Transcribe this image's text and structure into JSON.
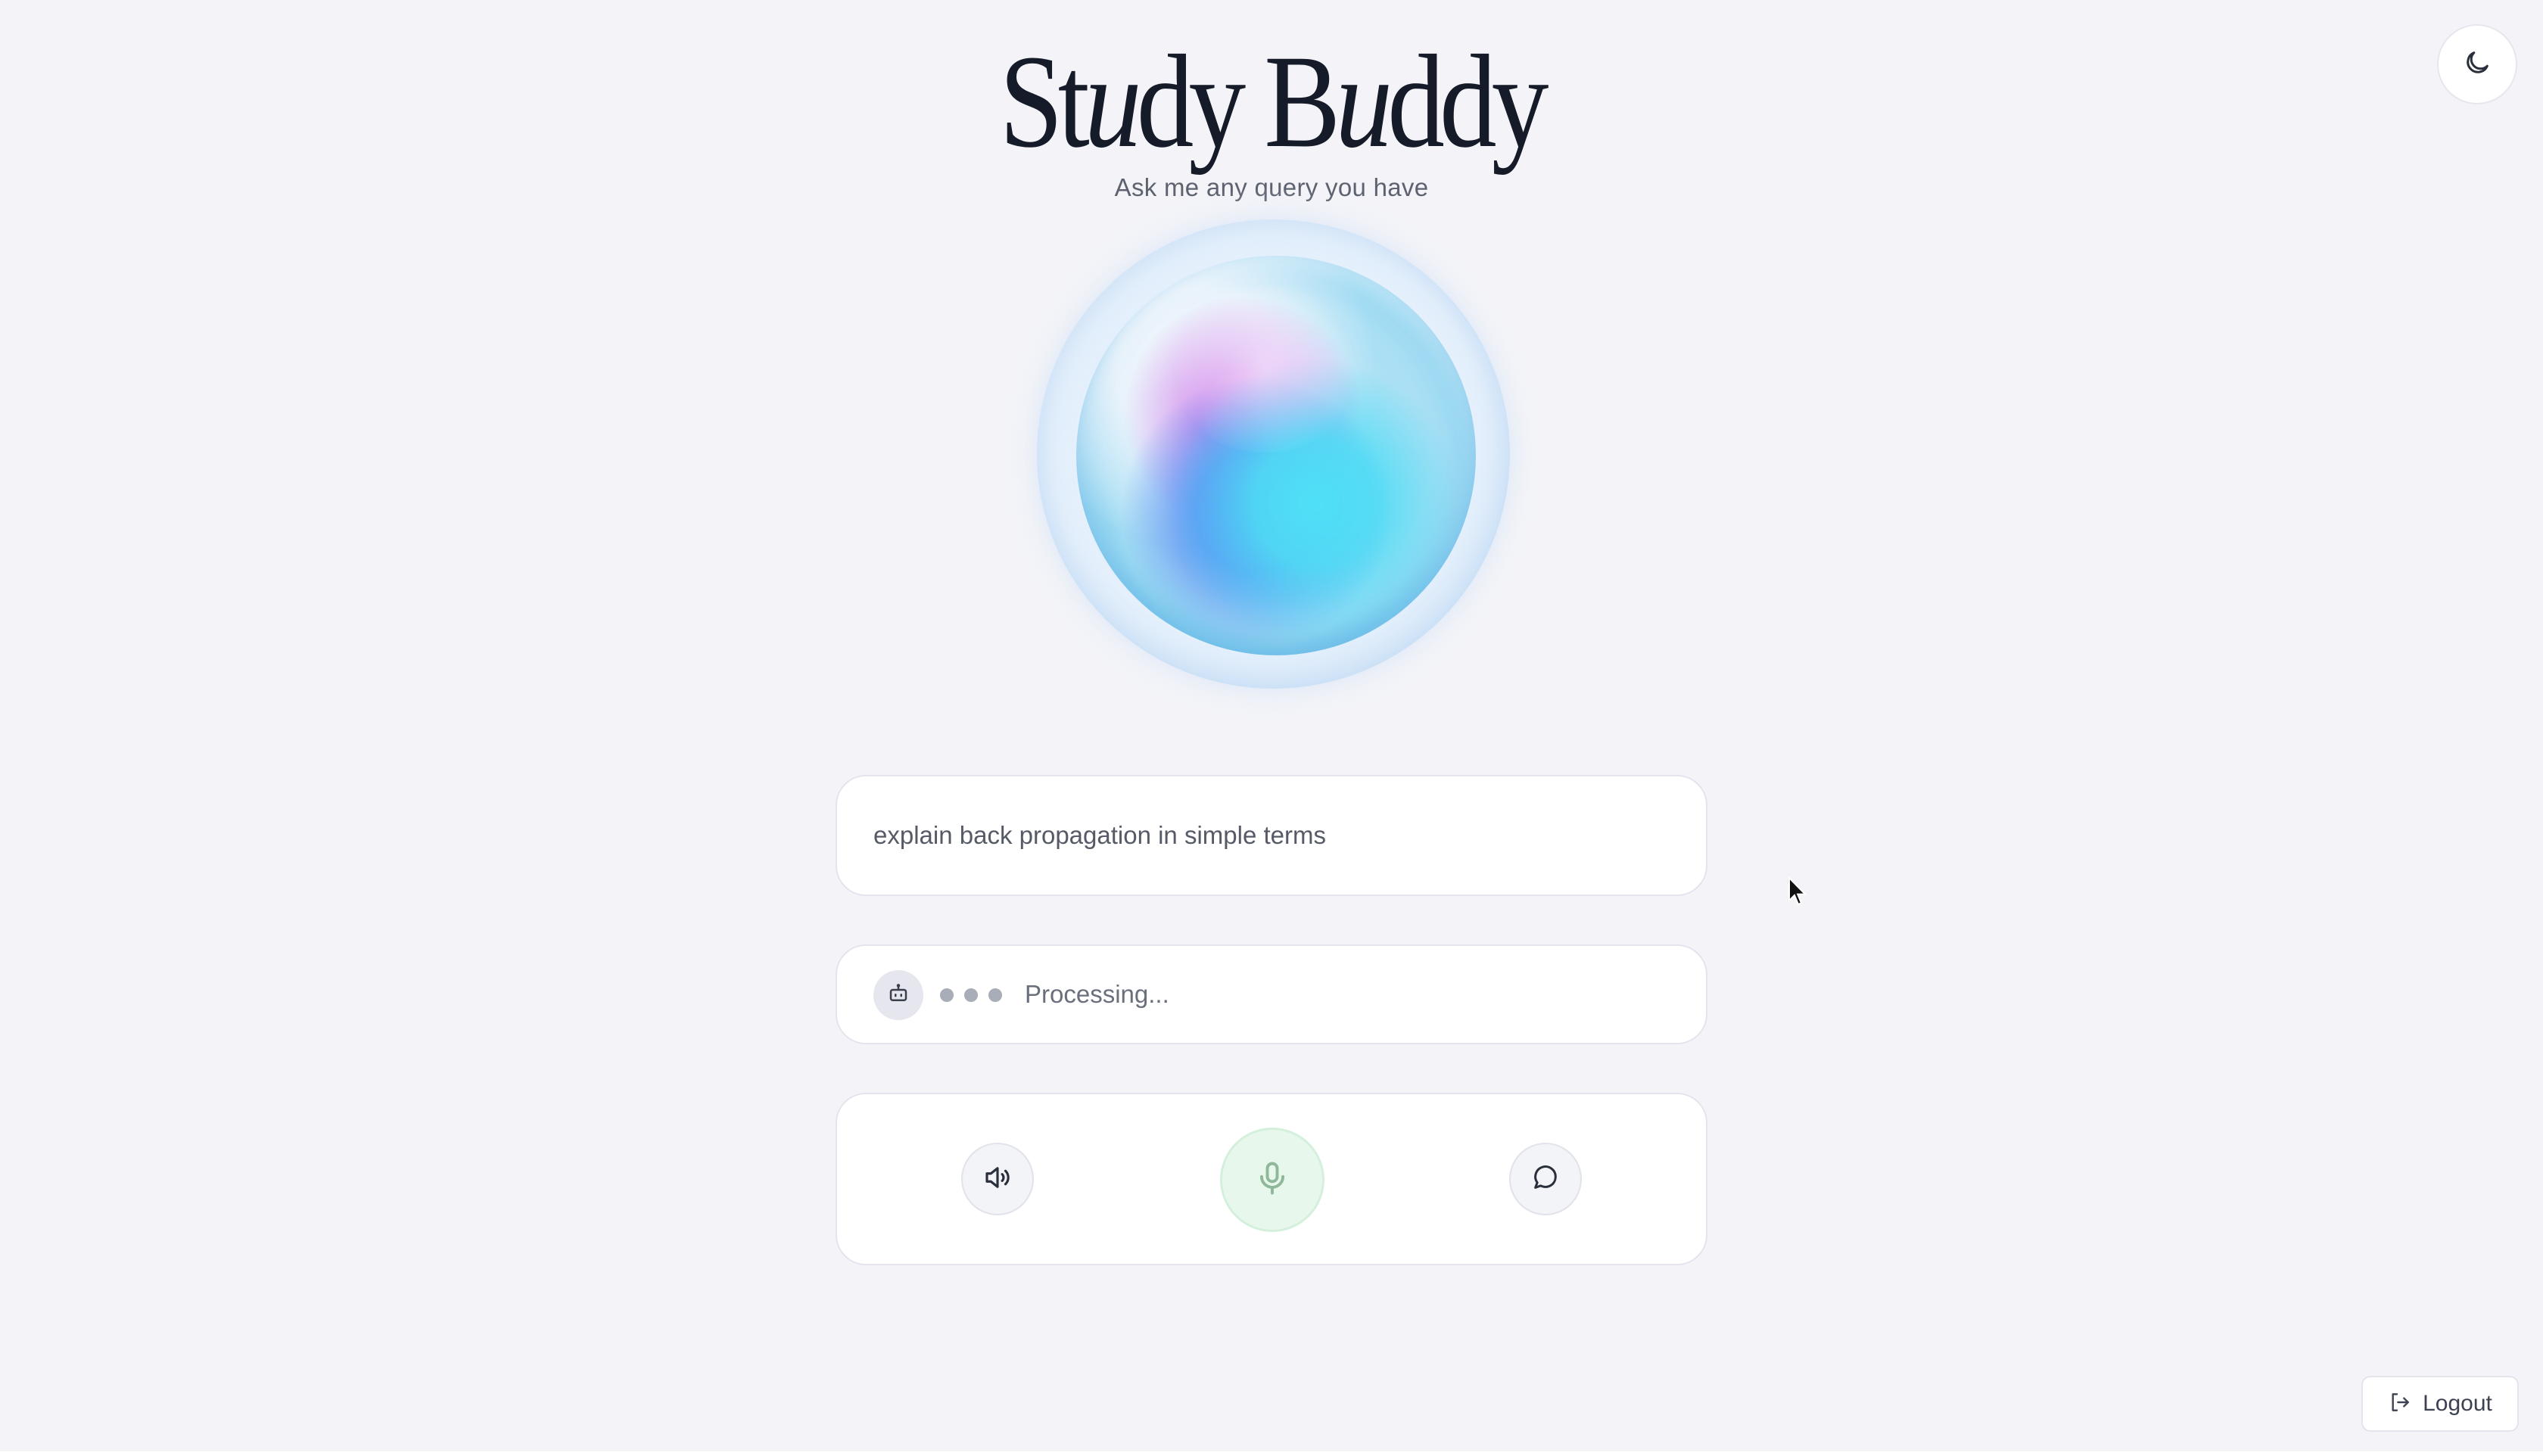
{
  "header": {
    "title_parts": [
      "St",
      "u",
      "dy B",
      "u",
      "ddy"
    ],
    "subtitle": "Ask me any query you have"
  },
  "theme_toggle": {
    "icon": "moon-icon"
  },
  "orb": {
    "icon": "orb-visualizer"
  },
  "query": {
    "text": "explain back propagation in simple terms"
  },
  "status": {
    "icon": "bot-icon",
    "text": "Processing..."
  },
  "controls": {
    "speaker_icon": "speaker-icon",
    "mic_icon": "microphone-icon",
    "chat_icon": "chat-bubble-icon",
    "mic_accent": "#e8f7ec"
  },
  "logout": {
    "label": "Logout",
    "icon": "logout-icon"
  },
  "colors": {
    "background": "#f4f4f8",
    "card": "#ffffff",
    "title": "#161b29"
  }
}
